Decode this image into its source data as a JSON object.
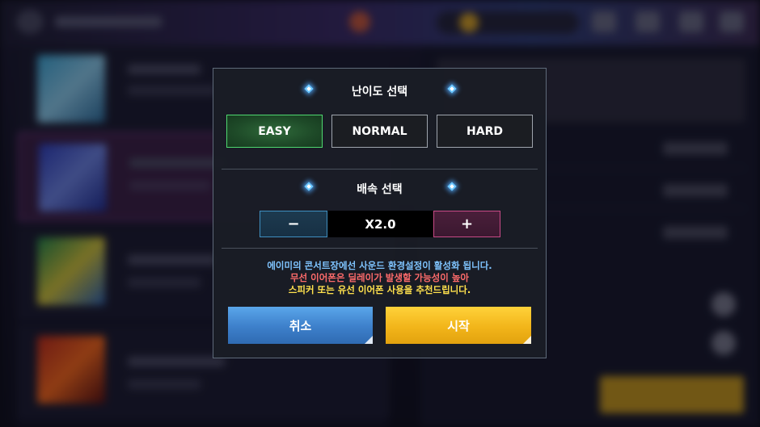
{
  "dialog": {
    "difficulty_title": "난이도 선택",
    "difficulty_options": [
      "EASY",
      "NORMAL",
      "HARD"
    ],
    "selected_difficulty": "EASY",
    "speed_title": "배속 선택",
    "speed_minus_label": "−",
    "speed_value": "X2.0",
    "speed_plus_label": "+",
    "notice_lines": [
      {
        "text": "에이미의 콘서트장에선 사운드 환경설정이 활성화 됩니다.",
        "color": "#7fc4ff"
      },
      {
        "text": "무선 이어폰은 딜레이가 발생할 가능성이 높아",
        "color": "#ff6b6b"
      },
      {
        "text": "스피커 또는 유선 이어폰 사용을 추천드립니다.",
        "color": "#ffe14d"
      }
    ],
    "cancel_label": "취소",
    "start_label": "시작"
  },
  "colors": {
    "easy_active_border": "#4fd870",
    "cancel_button": "#3d7fca",
    "start_button": "#f2b51a",
    "speed_minus_border": "#3f8fc0",
    "speed_plus_border": "#c84a86"
  },
  "icons": [
    "sparkle-icon"
  ]
}
